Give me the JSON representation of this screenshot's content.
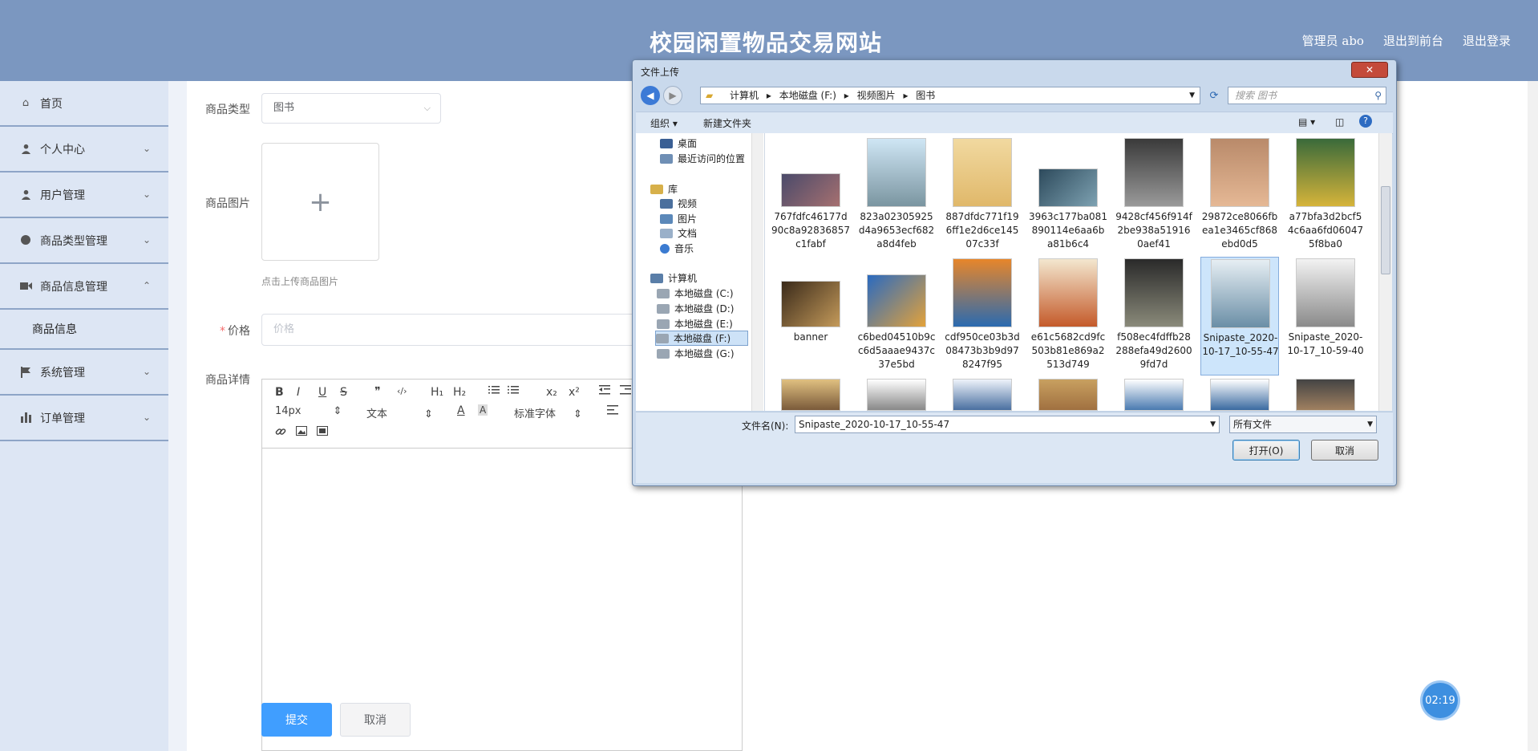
{
  "header": {
    "title": "校园闲置物品交易网站",
    "links": [
      "管理员 abo",
      "退出到前台",
      "退出登录"
    ]
  },
  "sidebar": {
    "items": [
      {
        "label": "首页",
        "icon": "home-icon"
      },
      {
        "label": "个人中心",
        "icon": "user-icon"
      },
      {
        "label": "用户管理",
        "icon": "user-icon"
      },
      {
        "label": "商品类型管理",
        "icon": "location-icon"
      },
      {
        "label": "商品信息管理",
        "icon": "video-icon"
      },
      {
        "label": "商品信息",
        "icon": ""
      },
      {
        "label": "系统管理",
        "icon": "flag-icon"
      },
      {
        "label": "订单管理",
        "icon": "chart-icon"
      }
    ]
  },
  "form": {
    "type_label": "商品类型",
    "type_value": "图书",
    "image_label": "商品图片",
    "image_plus": "+",
    "upload_hint": "点击上传商品图片",
    "price_label": "价格",
    "price_placeholder": "价格",
    "detail_label": "商品详情",
    "submit": "提交",
    "cancel": "取消"
  },
  "editor": {
    "bold": "B",
    "italic": "I",
    "underline": "U",
    "strike": "S",
    "quote": "❞",
    "code": "‹/›",
    "h1": "H₁",
    "h2": "H₂",
    "sub": "x₂",
    "sup": "x²",
    "font_size": "14px",
    "text_type": "文本",
    "font_family": "标准字体",
    "color_a": "A",
    "bg_a": "A"
  },
  "timer": "02:19",
  "dialog": {
    "title": "文件上传",
    "close": "✕",
    "breadcrumb": [
      "计算机",
      "本地磁盘 (F:)",
      "视频图片",
      "图书"
    ],
    "search_placeholder": "搜索 图书",
    "organize": "组织 ▾",
    "new_folder": "新建文件夹",
    "nav": {
      "desktop": "桌面",
      "recent": "最近访问的位置",
      "library": "库",
      "video": "视频",
      "pictures": "图片",
      "docs": "文档",
      "music": "音乐",
      "computer": "计算机",
      "drives": [
        "本地磁盘 (C:)",
        "本地磁盘 (D:)",
        "本地磁盘 (E:)",
        "本地磁盘 (F:)",
        "本地磁盘 (G:)"
      ]
    },
    "files_row1": [
      "767fdfc46177d90c8a92836857c1fabf",
      "823a02305925d4a9653ecf682a8d4feb",
      "887dfdc771f196ff1e2d6ce14507c33f",
      "3963c177ba081890114e6aa6ba81b6c4",
      "9428cf456f914f2be938a519160aef41",
      "29872ce8066fbea1e3465cf868ebd0d5",
      "a77bfa3d2bcf54c6aa6fd060475f8ba0"
    ],
    "files_row2": [
      "banner",
      "c6bed04510b9cc6d5aaae9437c37e5bd",
      "cdf950ce03b3d08473b3b9d978247f95",
      "e61c5682cd9fc503b81e869a2513d749",
      "f508ec4fdffb28288efa49d26009fd7d",
      "Snipaste_2020-10-17_10-55-47",
      "Snipaste_2020-10-17_10-59-40"
    ],
    "filename_label": "文件名(N):",
    "filename_value": "Snipaste_2020-10-17_10-55-47",
    "filetype": "所有文件",
    "open": "打开(O)",
    "cancel": "取消"
  },
  "colors": {
    "header_bg": "#7b97c0",
    "sidebar_bg": "#dde6f4",
    "primary": "#409eff"
  }
}
